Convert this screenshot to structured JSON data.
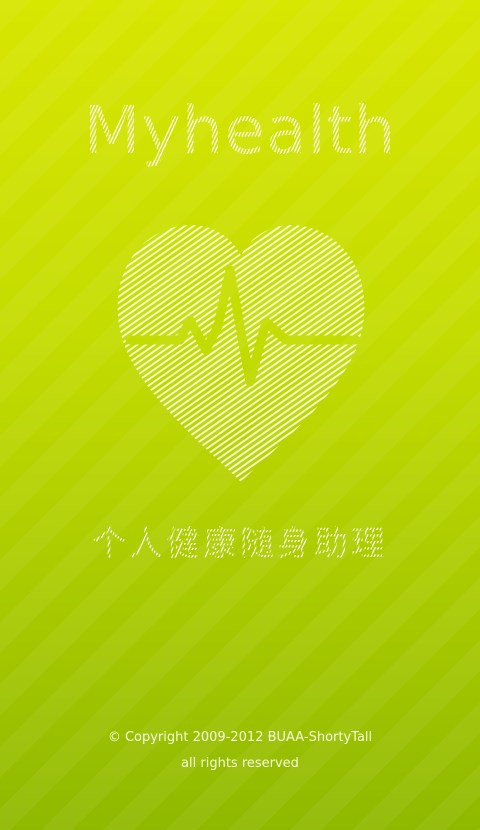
{
  "app": {
    "title": "Myhealth",
    "tagline": "个人健康随身助理"
  },
  "footer": {
    "copyright": "© Copyright 2009-2012 BUAA-ShortyTall",
    "rights": "all rights reserved"
  },
  "icons": {
    "logo": "heart-pulse-icon"
  },
  "colors": {
    "background_top": "#d8e600",
    "background_bottom": "#8fb900",
    "foreground": "#ffffff"
  }
}
